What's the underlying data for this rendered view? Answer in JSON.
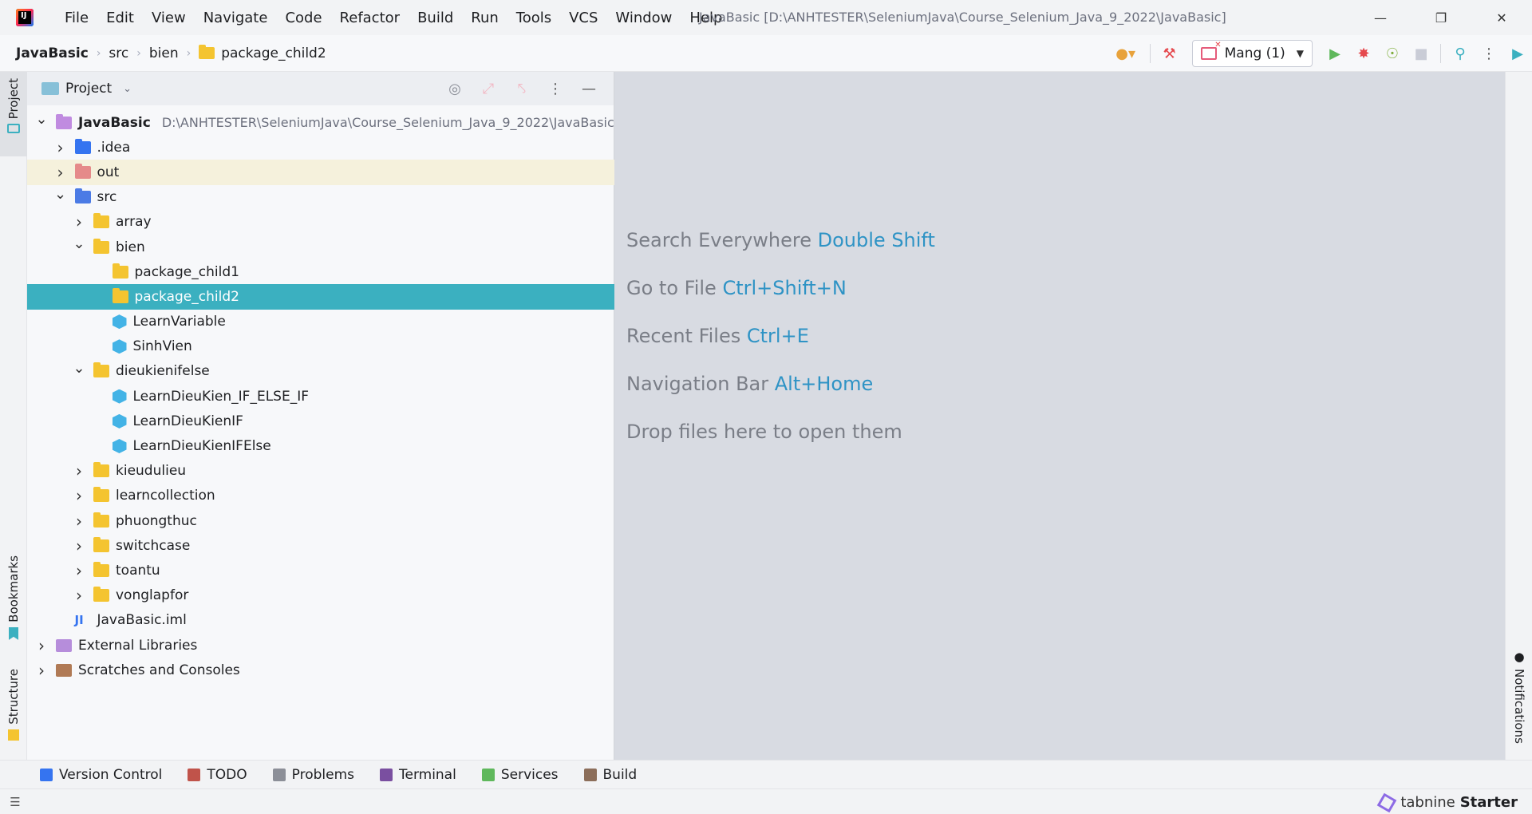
{
  "titlebar": {
    "logo_text": "IJ",
    "menu": [
      "File",
      "Edit",
      "View",
      "Navigate",
      "Code",
      "Refactor",
      "Build",
      "Run",
      "Tools",
      "VCS",
      "Window",
      "Help"
    ],
    "window_title": "JavaBasic [D:\\ANHTESTER\\SeleniumJava\\Course_Selenium_Java_9_2022\\JavaBasic]"
  },
  "breadcrumb": {
    "items": [
      "JavaBasic",
      "src",
      "bien",
      "package_child2"
    ]
  },
  "toolbar": {
    "run_config": "Mang (1)"
  },
  "left_strip": {
    "project_tab": "Project",
    "bookmarks_tab": "Bookmarks",
    "structure_tab": "Structure"
  },
  "project_panel": {
    "title": "Project",
    "tree": [
      {
        "label": "JavaBasic",
        "path": "D:\\ANHTESTER\\SeleniumJava\\Course_Selenium_Java_9_2022\\JavaBasic",
        "depth": 0,
        "state": "open",
        "icon": "module-folder-icon",
        "root": true
      },
      {
        "label": ".idea",
        "depth": 1,
        "state": "closed",
        "icon": "idea-folder-icon"
      },
      {
        "label": "out",
        "depth": 1,
        "state": "closed",
        "icon": "excluded-folder-icon",
        "hover": true
      },
      {
        "label": "src",
        "depth": 1,
        "state": "open",
        "icon": "source-folder-icon"
      },
      {
        "label": "array",
        "depth": 2,
        "state": "closed",
        "icon": "package-folder-icon"
      },
      {
        "label": "bien",
        "depth": 2,
        "state": "open",
        "icon": "package-folder-icon"
      },
      {
        "label": "package_child1",
        "depth": 3,
        "state": "leaf",
        "icon": "package-folder-icon"
      },
      {
        "label": "package_child2",
        "depth": 3,
        "state": "leaf",
        "icon": "package-folder-icon",
        "selected": true
      },
      {
        "label": "LearnVariable",
        "depth": 3,
        "state": "leaf",
        "icon": "java-class-icon"
      },
      {
        "label": "SinhVien",
        "depth": 3,
        "state": "leaf",
        "icon": "java-class-icon"
      },
      {
        "label": "dieukienifelse",
        "depth": 2,
        "state": "open",
        "icon": "package-folder-icon"
      },
      {
        "label": "LearnDieuKien_IF_ELSE_IF",
        "depth": 3,
        "state": "leaf",
        "icon": "java-class-icon"
      },
      {
        "label": "LearnDieuKienIF",
        "depth": 3,
        "state": "leaf",
        "icon": "java-class-icon"
      },
      {
        "label": "LearnDieuKienIFElse",
        "depth": 3,
        "state": "leaf",
        "icon": "java-class-icon"
      },
      {
        "label": "kieudulieu",
        "depth": 2,
        "state": "closed",
        "icon": "package-folder-icon"
      },
      {
        "label": "learncollection",
        "depth": 2,
        "state": "closed",
        "icon": "package-folder-icon"
      },
      {
        "label": "phuongthuc",
        "depth": 2,
        "state": "closed",
        "icon": "package-folder-icon"
      },
      {
        "label": "switchcase",
        "depth": 2,
        "state": "closed",
        "icon": "package-folder-icon"
      },
      {
        "label": "toantu",
        "depth": 2,
        "state": "closed",
        "icon": "package-folder-icon"
      },
      {
        "label": "vonglapfor",
        "depth": 2,
        "state": "closed",
        "icon": "package-folder-icon"
      },
      {
        "label": "JavaBasic.iml",
        "depth": 1,
        "state": "leaf",
        "icon": "iml-file-icon"
      },
      {
        "label": "External Libraries",
        "depth": 0,
        "state": "closed",
        "icon": "library-icon"
      },
      {
        "label": "Scratches and Consoles",
        "depth": 0,
        "state": "closed",
        "icon": "scratches-icon"
      }
    ]
  },
  "editor_hints": [
    {
      "text": "Search Everywhere",
      "key": "Double Shift"
    },
    {
      "text": "Go to File",
      "key": "Ctrl+Shift+N"
    },
    {
      "text": "Recent Files",
      "key": "Ctrl+E"
    },
    {
      "text": "Navigation Bar",
      "key": "Alt+Home"
    },
    {
      "text": "Drop files here to open them",
      "key": ""
    }
  ],
  "right_strip": {
    "notifications_tab": "Notifications"
  },
  "bottom_tabs": [
    {
      "label": "Version Control",
      "icon": "version-control-icon",
      "color": "#3574f0"
    },
    {
      "label": "TODO",
      "icon": "todo-icon",
      "color": "#c0534a"
    },
    {
      "label": "Problems",
      "icon": "problems-icon",
      "color": "#8c8f98"
    },
    {
      "label": "Terminal",
      "icon": "terminal-icon",
      "color": "#7a4fa0"
    },
    {
      "label": "Services",
      "icon": "services-icon",
      "color": "#5fb85c"
    },
    {
      "label": "Build",
      "icon": "build-icon",
      "color": "#8c6e5a"
    }
  ],
  "statusbar": {
    "tabnine_brand": "tabnine",
    "tabnine_plan": "Starter"
  },
  "colors": {
    "selection": "#3bb0c0",
    "hint_key": "#2e93c5",
    "editor_bg": "#d8dbe2"
  }
}
